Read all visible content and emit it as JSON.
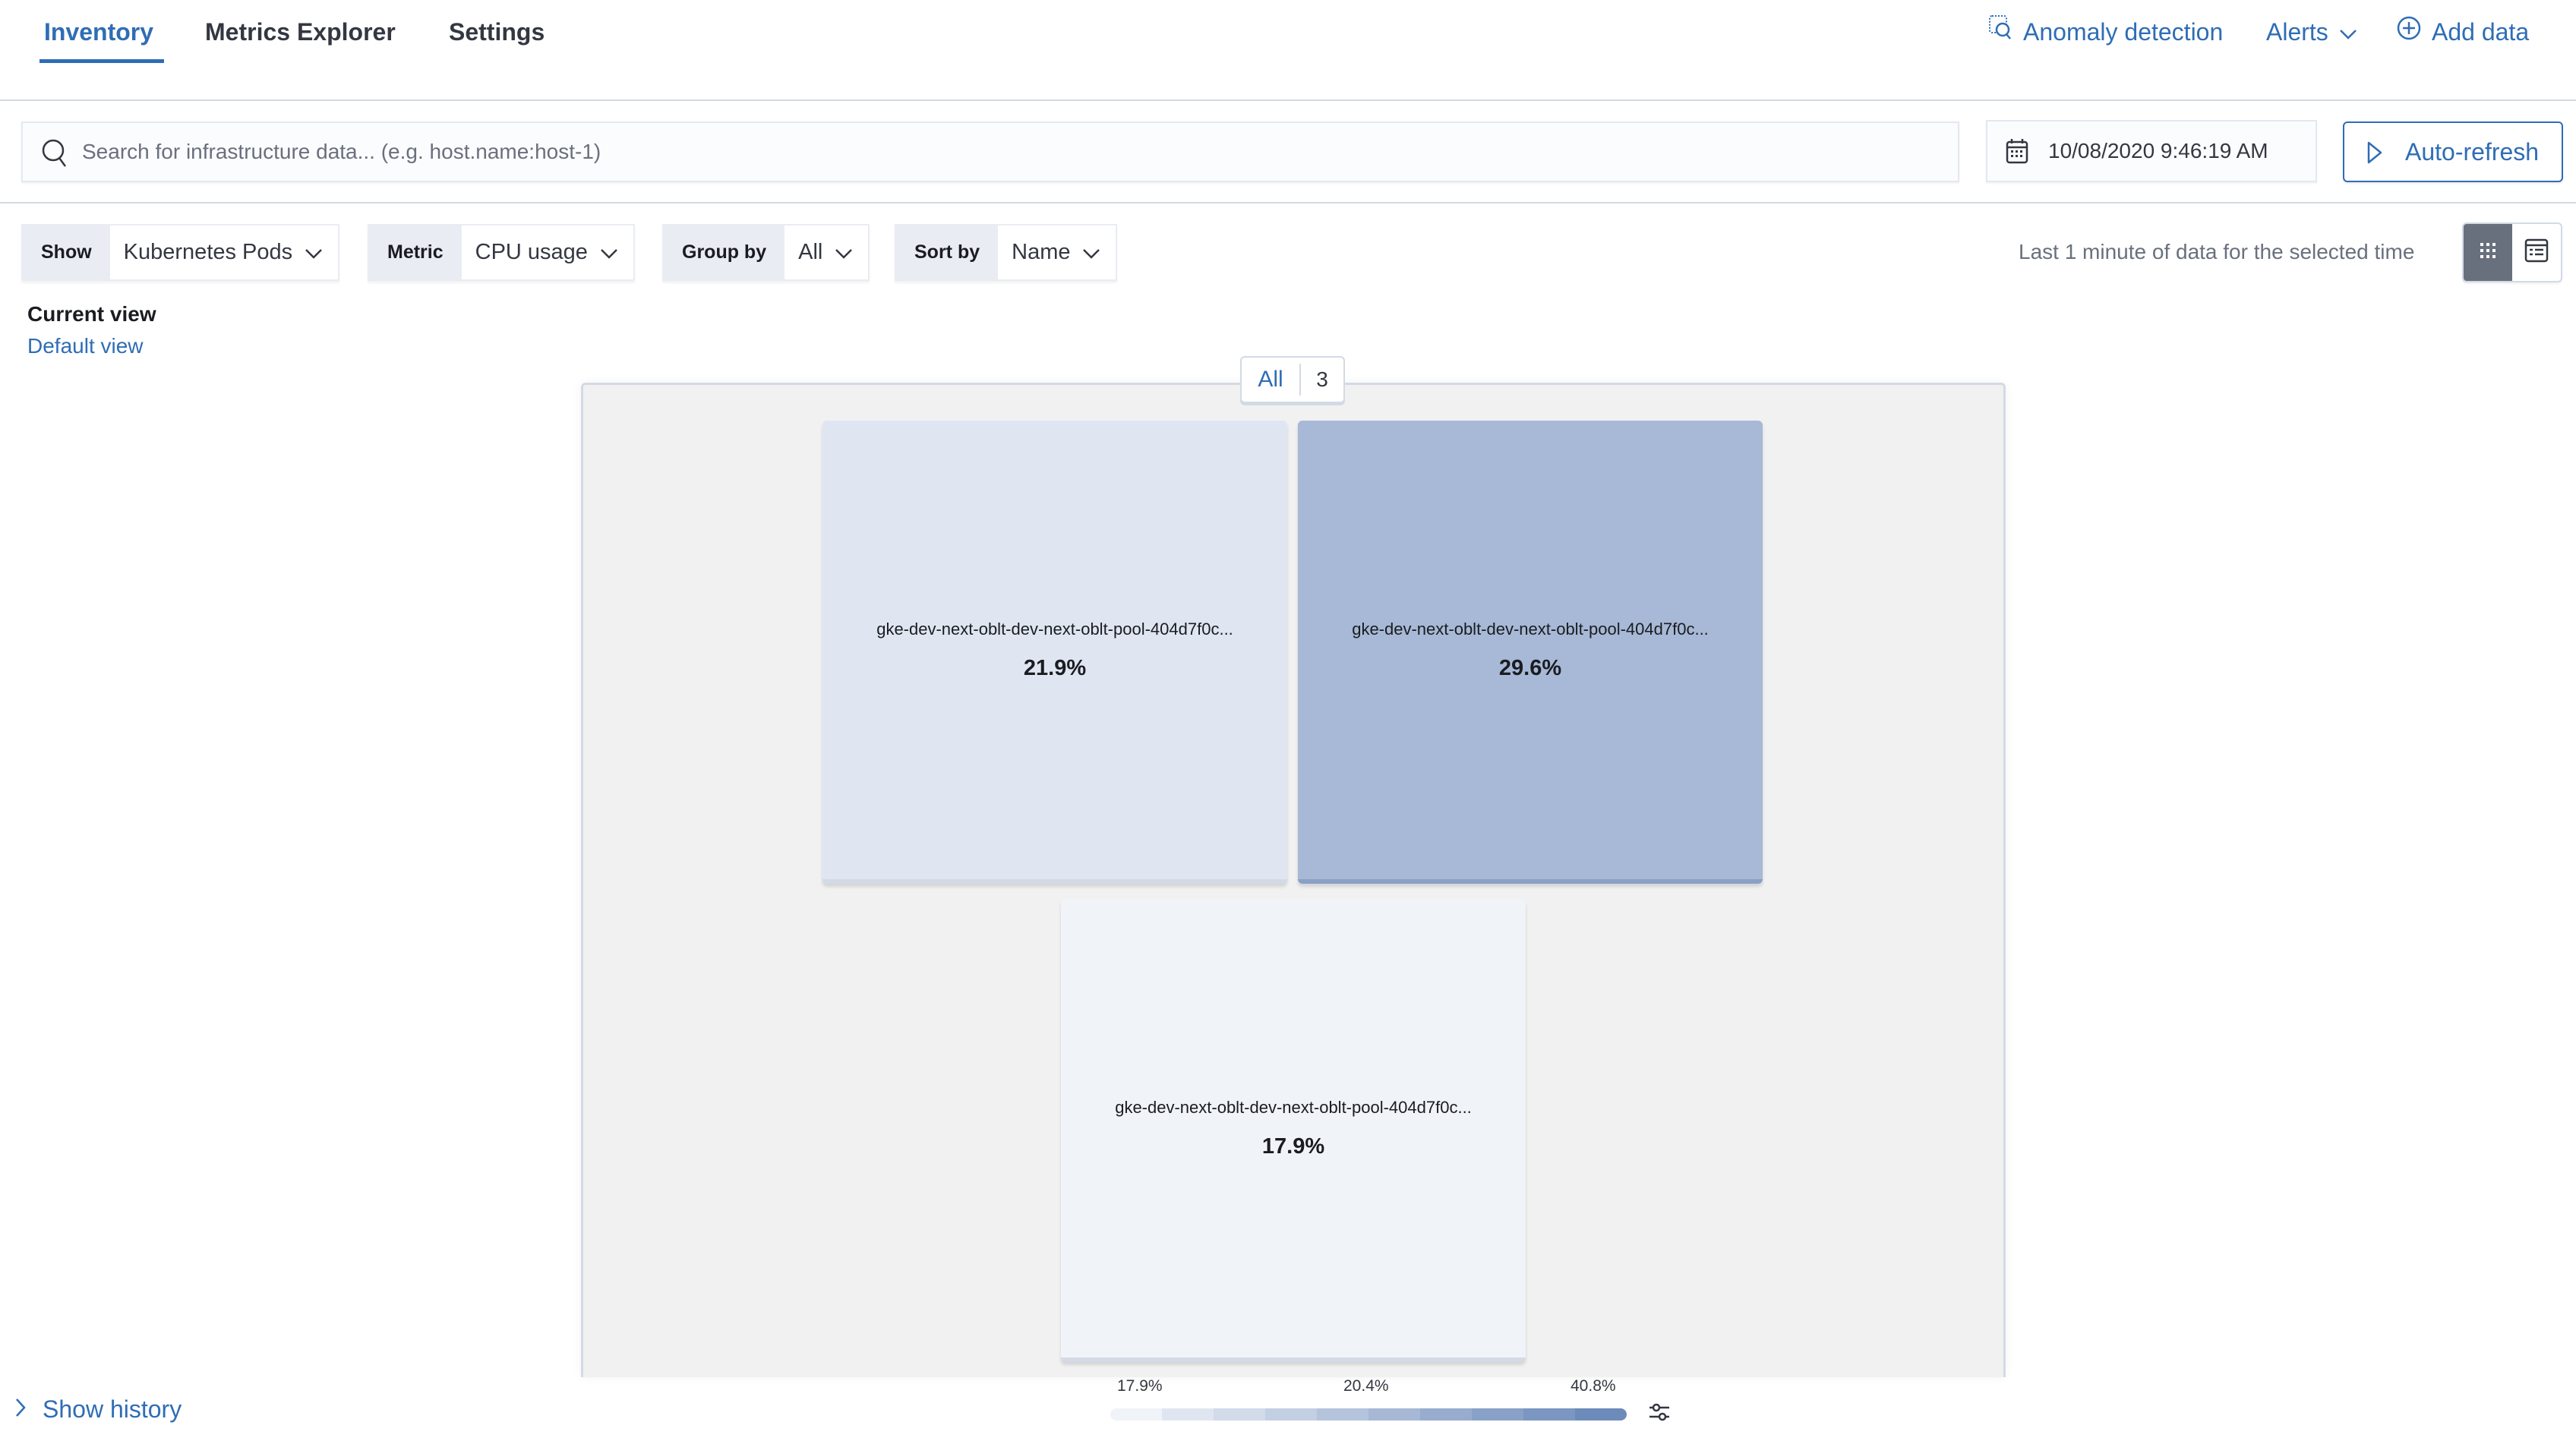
{
  "header": {
    "tabs": [
      {
        "label": "Inventory",
        "active": true
      },
      {
        "label": "Metrics Explorer",
        "active": false
      },
      {
        "label": "Settings",
        "active": false
      }
    ],
    "actions": {
      "anomaly_detection": "Anomaly detection",
      "alerts": "Alerts",
      "add_data": "Add data"
    }
  },
  "search": {
    "placeholder": "Search for infrastructure data... (e.g. host.name:host-1)",
    "value": ""
  },
  "date_picker": {
    "value": "10/08/2020 9:46:19 AM"
  },
  "auto_refresh": {
    "label": "Auto-refresh"
  },
  "filters": {
    "show": {
      "label": "Show",
      "value": "Kubernetes Pods"
    },
    "metric": {
      "label": "Metric",
      "value": "CPU usage"
    },
    "group_by": {
      "label": "Group by",
      "value": "All"
    },
    "sort_by": {
      "label": "Sort by",
      "value": "Name"
    }
  },
  "time_note": "Last 1 minute of data for the selected time",
  "view_toggle": {
    "selected": "map",
    "options": [
      "map-icon",
      "table-icon"
    ]
  },
  "current_view": {
    "title": "Current view",
    "name": "Default view"
  },
  "map": {
    "group": {
      "label": "All",
      "count": "3"
    },
    "nodes": [
      {
        "name": "gke-dev-next-oblt-dev-next-oblt-pool-404d7f0c...",
        "value": "21.9%",
        "color": "#e0e6f1"
      },
      {
        "name": "gke-dev-next-oblt-dev-next-oblt-pool-404d7f0c...",
        "value": "29.6%",
        "color": "#a7b9d6"
      },
      {
        "name": "gke-dev-next-oblt-dev-next-oblt-pool-404d7f0c...",
        "value": "17.9%",
        "color": "#f0f3f8"
      }
    ]
  },
  "legend": {
    "min": "17.9%",
    "mid": "20.4%",
    "max": "40.8%",
    "steps": [
      "#f0f3f8",
      "#e0e6f1",
      "#d2dbea",
      "#c3cfe2",
      "#b4c4dc",
      "#a6b8d5",
      "#98acce",
      "#89a1c7",
      "#7b96c1",
      "#6d8bba"
    ]
  },
  "footer": {
    "show_history": "Show history"
  },
  "colors": {
    "accent": "#2f6db5",
    "text": "#343741",
    "muted": "#69707d",
    "border": "#d3dae6"
  }
}
